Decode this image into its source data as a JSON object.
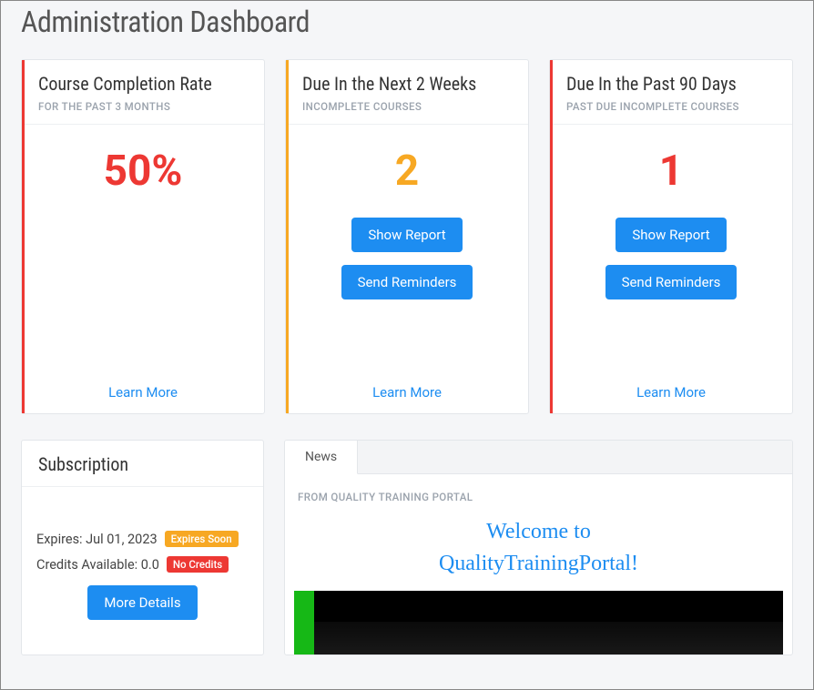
{
  "page_title": "Administration Dashboard",
  "cards": [
    {
      "title": "Course Completion Rate",
      "subtitle": "FOR THE PAST 3 MONTHS",
      "value": "50%",
      "accent": "red",
      "value_color": "red",
      "learn_more": "Learn More"
    },
    {
      "title": "Due In the Next 2 Weeks",
      "subtitle": "INCOMPLETE COURSES",
      "value": "2",
      "accent": "orange",
      "value_color": "orange",
      "show_report": "Show Report",
      "send_reminders": "Send Reminders",
      "learn_more": "Learn More"
    },
    {
      "title": "Due In the Past 90 Days",
      "subtitle": "PAST DUE INCOMPLETE COURSES",
      "value": "1",
      "accent": "red",
      "value_color": "red",
      "show_report": "Show Report",
      "send_reminders": "Send Reminders",
      "learn_more": "Learn More"
    }
  ],
  "subscription": {
    "title": "Subscription",
    "expires_label": "Expires: Jul 01, 2023",
    "expires_badge": "Expires Soon",
    "credits_label": "Credits Available: 0.0",
    "credits_badge": "No Credits",
    "more_details": "More Details"
  },
  "news": {
    "tab_label": "News",
    "from_label": "FROM QUALITY TRAINING PORTAL",
    "welcome_line1": "Welcome to",
    "welcome_line2": "QualityTrainingPortal!"
  }
}
